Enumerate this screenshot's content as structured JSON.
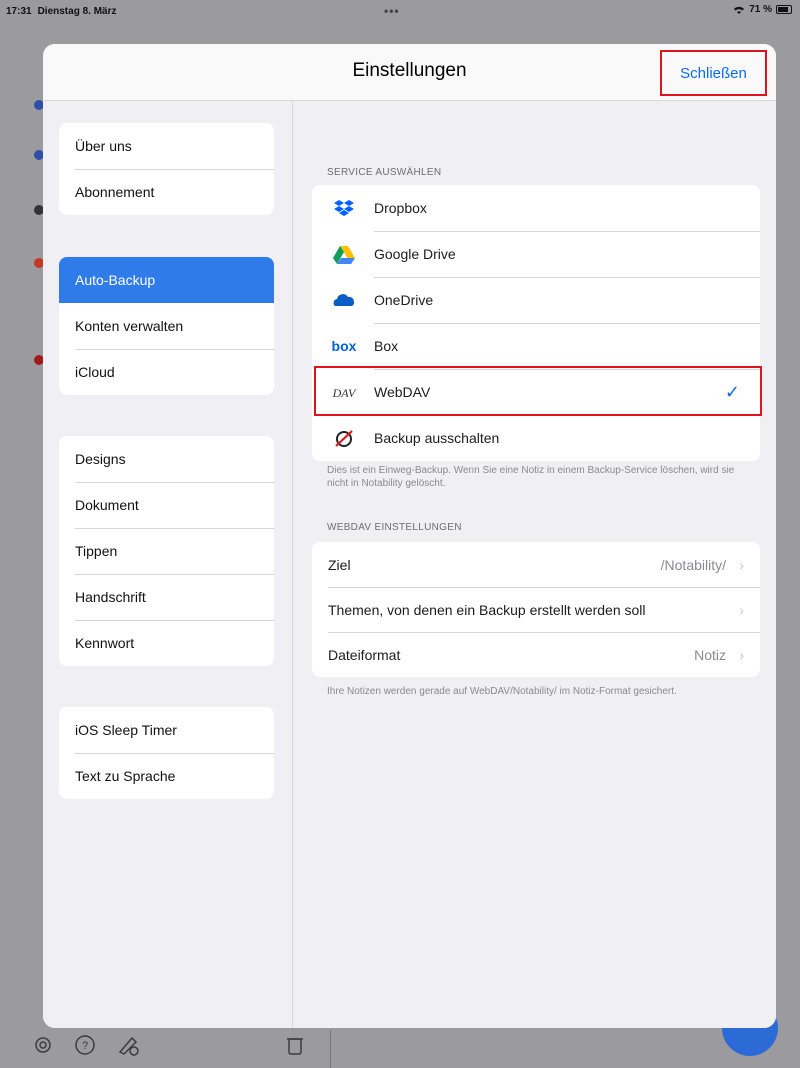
{
  "status_bar": {
    "time": "17:31",
    "date": "Dienstag 8. März",
    "dots": "•••",
    "battery": "71 %"
  },
  "modal": {
    "title": "Einstellungen",
    "close_label": "Schließen"
  },
  "sidebar": {
    "groups": [
      {
        "items": [
          {
            "label": "Über uns"
          },
          {
            "label": "Abonnement"
          }
        ]
      },
      {
        "items": [
          {
            "label": "Auto-Backup",
            "active": true
          },
          {
            "label": "Konten verwalten"
          },
          {
            "label": "iCloud"
          }
        ]
      },
      {
        "items": [
          {
            "label": "Designs"
          },
          {
            "label": "Dokument"
          },
          {
            "label": "Tippen"
          },
          {
            "label": "Handschrift"
          },
          {
            "label": "Kennwort"
          }
        ]
      },
      {
        "items": [
          {
            "label": "iOS Sleep Timer"
          },
          {
            "label": "Text zu Sprache"
          }
        ]
      }
    ]
  },
  "service_section": {
    "header": "SERVICE AUSWÄHLEN",
    "services": [
      {
        "label": "Dropbox",
        "icon": "dropbox-icon"
      },
      {
        "label": "Google Drive",
        "icon": "google-drive-icon"
      },
      {
        "label": "OneDrive",
        "icon": "onedrive-icon"
      },
      {
        "label": "Box",
        "icon": "box-icon"
      },
      {
        "label": "WebDAV",
        "icon": "webdav-icon",
        "selected": true
      },
      {
        "label": "Backup ausschalten",
        "icon": "backup-off-icon"
      }
    ],
    "check": "✓",
    "footnote": "Dies ist ein Einweg-Backup. Wenn Sie eine Notiz in einem Backup-Service löschen, wird sie nicht in Notability gelöscht."
  },
  "webdav_section": {
    "header": "WEBDAV EINSTELLUNGEN",
    "rows": [
      {
        "label": "Ziel",
        "value": "/Notability/"
      },
      {
        "label": "Themen, von denen ein Backup erstellt werden soll",
        "value": ""
      },
      {
        "label": "Dateiformat",
        "value": "Notiz"
      }
    ],
    "footnote": "Ihre Notizen werden gerade auf WebDAV/Notability/ im Notiz-Format gesichert."
  },
  "colors": {
    "accent": "#0a6bf0",
    "active_bg": "#2f7bea",
    "annotation_red": "#e0141e"
  }
}
